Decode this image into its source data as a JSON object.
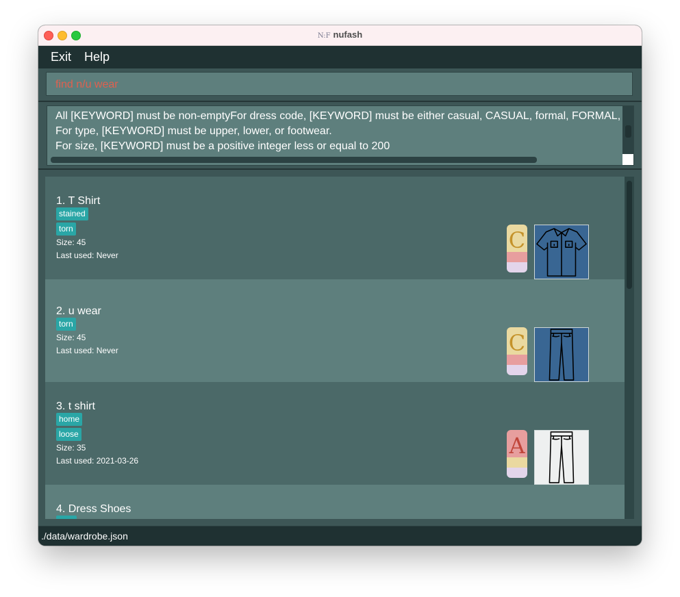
{
  "window": {
    "title": "nufash",
    "logo_text": "N:F"
  },
  "menu": {
    "exit": "Exit",
    "help": "Help"
  },
  "command_box": {
    "value": "find n/u wear"
  },
  "result_display": {
    "lines": [
      "All [KEYWORD] must be non-emptyFor dress code, [KEYWORD] must be either casual, CASUAL, formal, FORMAL,",
      "For type, [KEYWORD] must be upper, lower, or footwear.",
      "For size, [KEYWORD] must be a positive integer less or equal to 200"
    ]
  },
  "items": [
    {
      "index_name": "1.  T Shirt",
      "tags": [
        "stained",
        "torn"
      ],
      "size": "Size: 45",
      "last_used": "Last used: Never",
      "badge_letter": "C",
      "badge_letter_color": "#c4922a",
      "badge_colors": [
        "#ead9a0",
        "#e79e9e",
        "#e3d5eb"
      ],
      "image": "shirt-icon",
      "image_bg": "#396693"
    },
    {
      "index_name": "2.  u wear",
      "tags": [
        "torn"
      ],
      "size": "Size: 45",
      "last_used": "Last used: Never",
      "badge_letter": "C",
      "badge_letter_color": "#c4922a",
      "badge_colors": [
        "#ead9a0",
        "#e79e9e",
        "#e3d5eb"
      ],
      "image": "pants-icon",
      "image_bg": "#396693"
    },
    {
      "index_name": "3.  t shirt",
      "tags": [
        "home",
        "loose"
      ],
      "size": "Size: 35",
      "last_used": "Last used: 2021-03-26",
      "badge_letter": "A",
      "badge_letter_color": "#c0453a",
      "badge_colors": [
        "#e79e9e",
        "#ead9a0",
        "#e3d5eb"
      ],
      "image": "pants-icon",
      "image_bg": "#eef0f0"
    },
    {
      "index_name": "4.  Dress Shoes",
      "tags": [],
      "size": "",
      "last_used": "",
      "badge_letter": "",
      "badge_letter_color": "",
      "badge_colors": [],
      "image": "",
      "image_bg": ""
    }
  ],
  "status_bar": {
    "path": "./data/wardrobe.json"
  }
}
